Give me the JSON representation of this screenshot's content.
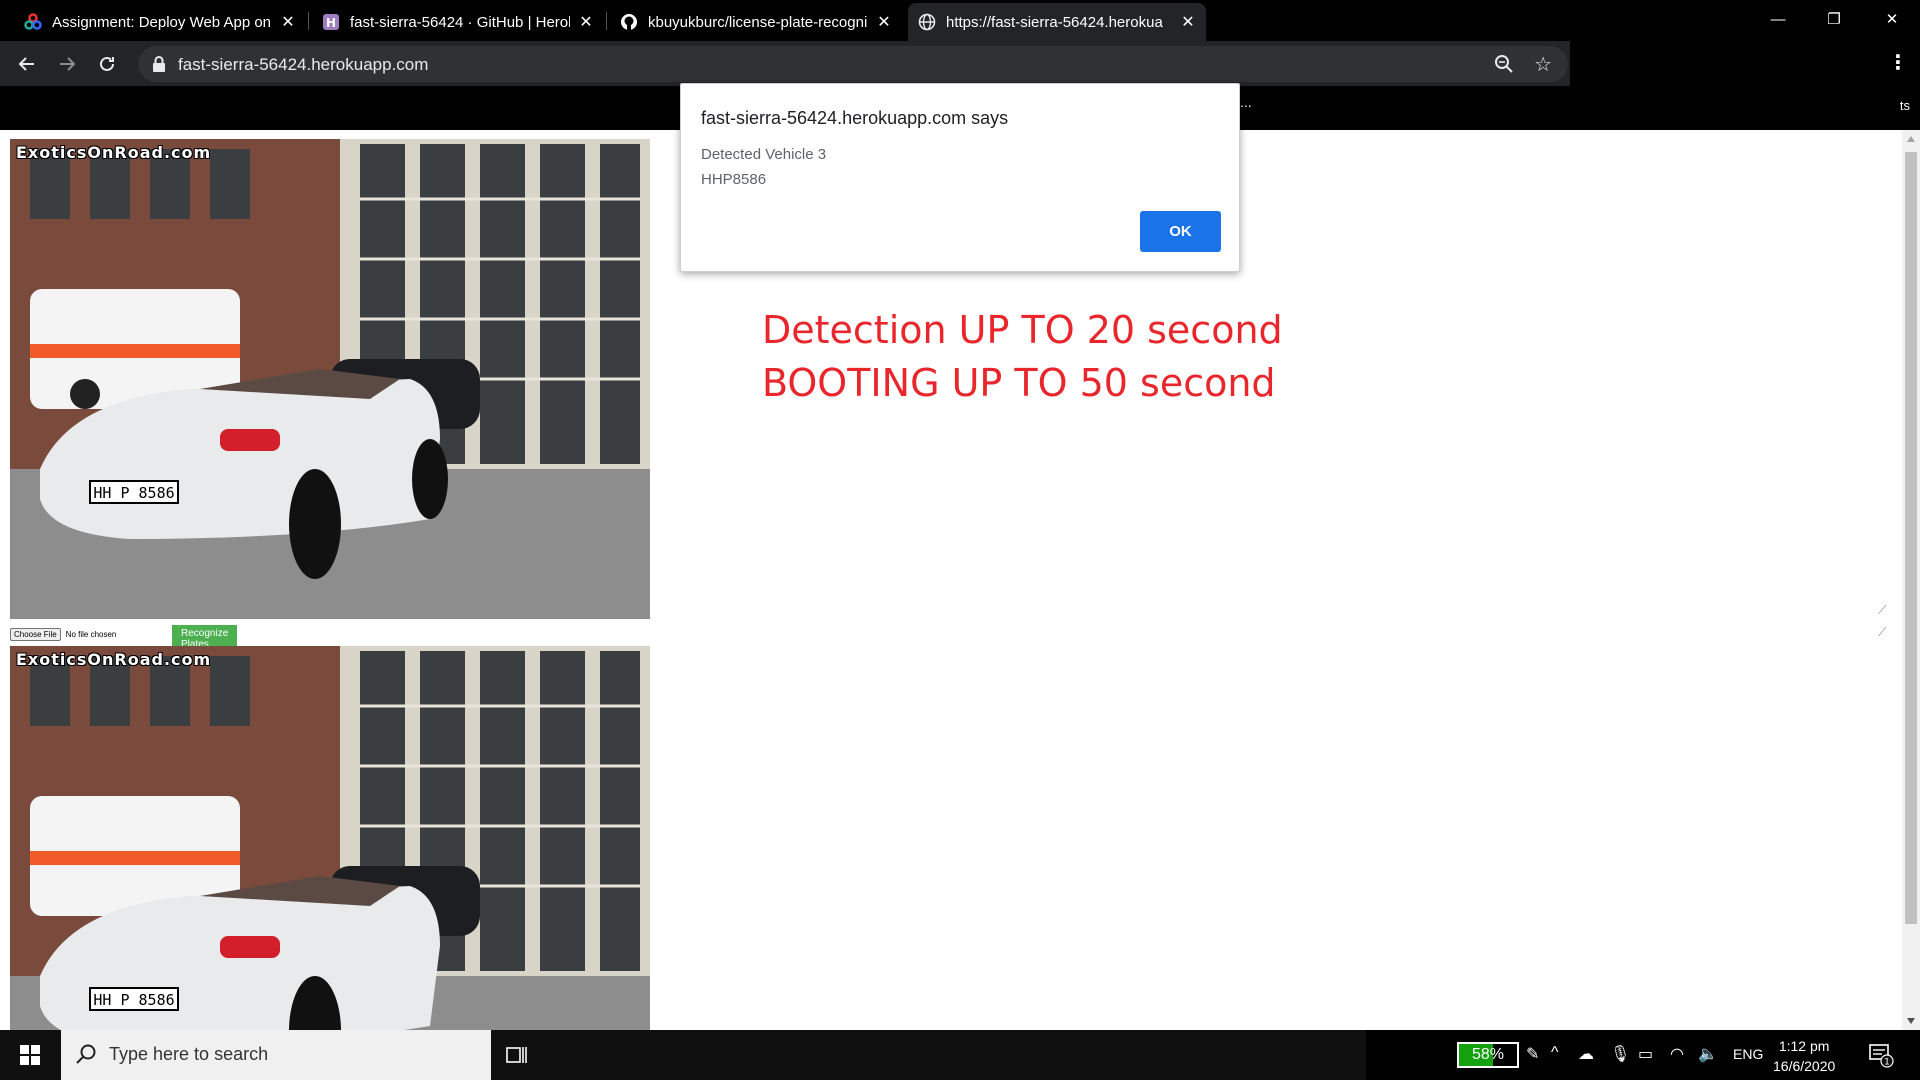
{
  "browser": {
    "tabs": [
      {
        "title": "Assignment: Deploy Web App on",
        "icon": "colorful-logo-icon"
      },
      {
        "title": "fast-sierra-56424 · GitHub | Herol",
        "icon": "heroku-icon"
      },
      {
        "title": "kbuyukburc/license-plate-recogni",
        "icon": "github-icon"
      },
      {
        "title": "https://fast-sierra-56424.herokua",
        "icon": "globe-icon"
      }
    ],
    "url": "fast-sierra-56424.herokuapp.com",
    "window_controls": {
      "minimize": "—",
      "restore": "❐",
      "close": "✕"
    }
  },
  "page": {
    "watermark": "ExoticsOnRoad.com",
    "choose_file_label": "Choose File",
    "no_file_label": "No file chosen",
    "recognize_label": "Recognize Plates",
    "warning_line1": "Detection UP TO 20 second",
    "warning_line2": "BOOTING UP TO 50 second",
    "accent_color": "#e8262b",
    "button_color": "#4caf50"
  },
  "dialog": {
    "title": "fast-sierra-56424.herokuapp.com says",
    "line1": "Detected Vehicle 3",
    "line2": "HHP8586",
    "ok_label": "OK"
  },
  "taskbar": {
    "search_placeholder": "Type here to search",
    "battery": "58%",
    "battery_level": 0.58,
    "language": "ENG",
    "time": "1:12 pm",
    "date": "16/6/2020",
    "notification_count": "1"
  }
}
